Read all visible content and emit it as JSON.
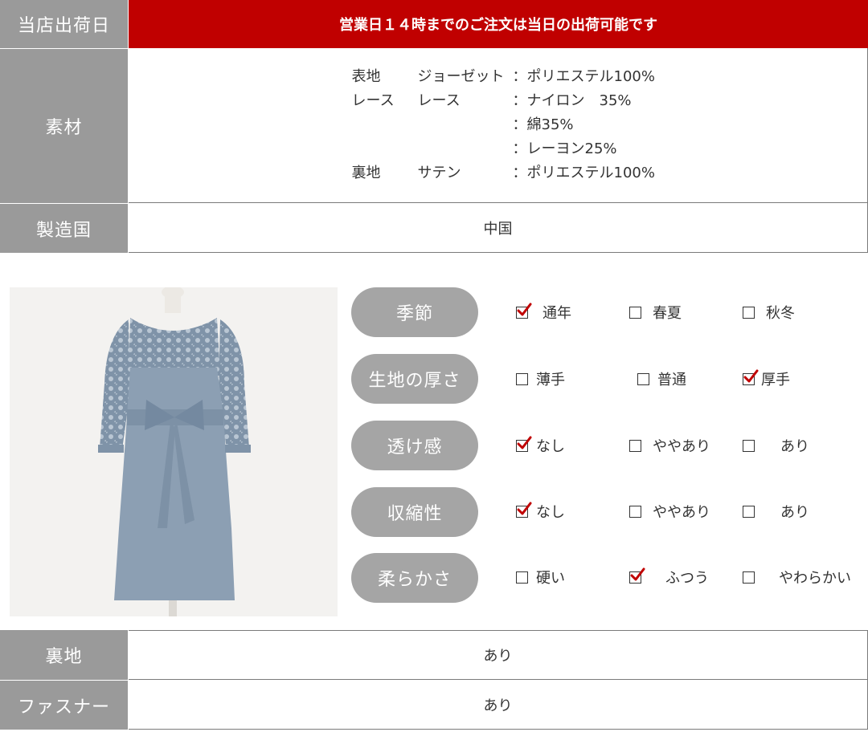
{
  "top_table": {
    "shipping": {
      "label": "当店出荷日",
      "value": "営業日１４時までのご注文は当日の出荷可能です"
    },
    "material": {
      "label": "素材",
      "lines": [
        {
          "part": "表地",
          "fabric": "ジョーゼット",
          "comp": "：ポリエステル100%"
        },
        {
          "part": "レース",
          "fabric": "レース",
          "comp": "：ナイロン　35%"
        },
        {
          "part": "",
          "fabric": "",
          "comp": "：綿35%"
        },
        {
          "part": "",
          "fabric": "",
          "comp": "：レーヨン25%"
        },
        {
          "part": "裏地",
          "fabric": "サテン",
          "comp": "：ポリエステル100%"
        }
      ]
    },
    "origin": {
      "label": "製造国",
      "value": "中国"
    }
  },
  "attributes": [
    {
      "label": "季節",
      "options": [
        {
          "text": "通年",
          "checked": true
        },
        {
          "text": "春夏",
          "checked": false
        },
        {
          "text": "秋冬",
          "checked": false
        }
      ]
    },
    {
      "label": "生地の厚さ",
      "options": [
        {
          "text": "薄手",
          "checked": false
        },
        {
          "text": "普通",
          "checked": false
        },
        {
          "text": "厚手",
          "checked": true
        }
      ]
    },
    {
      "label": "透け感",
      "options": [
        {
          "text": "なし",
          "checked": true
        },
        {
          "text": "ややあり",
          "checked": false
        },
        {
          "text": "あり",
          "checked": false
        }
      ]
    },
    {
      "label": "収縮性",
      "options": [
        {
          "text": "なし",
          "checked": true
        },
        {
          "text": "ややあり",
          "checked": false
        },
        {
          "text": "あり",
          "checked": false
        }
      ]
    },
    {
      "label": "柔らかさ",
      "options": [
        {
          "text": "硬い",
          "checked": false
        },
        {
          "text": "ふつう",
          "checked": true
        },
        {
          "text": "やわらかい",
          "checked": false
        }
      ]
    }
  ],
  "bottom_table": {
    "lining": {
      "label": "裏地",
      "value": "あり"
    },
    "zipper": {
      "label": "ファスナー",
      "value": "あり"
    }
  },
  "colors": {
    "header_red": "#c00000",
    "label_gray": "#9a9a9a",
    "pill_gray": "#a5a5a5",
    "check_red": "#c00000",
    "dress_blue": "#8c9fb3"
  }
}
